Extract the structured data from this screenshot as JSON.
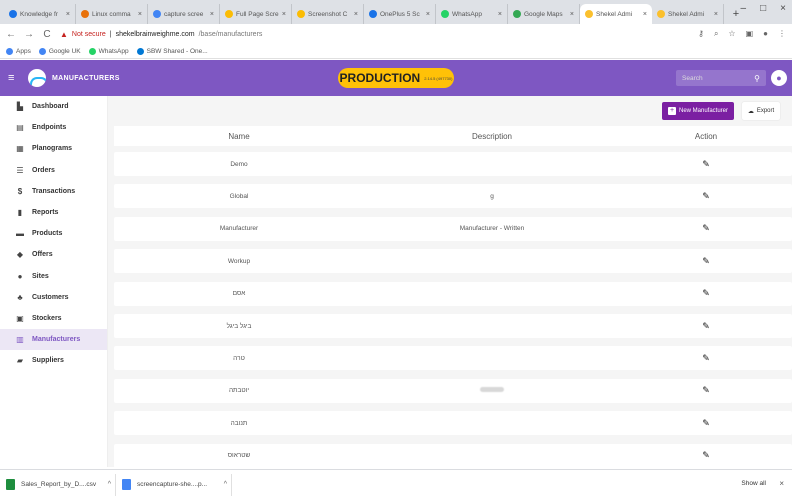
{
  "browser": {
    "tabs": [
      {
        "label": "Knowledge fr",
        "color": "#1a73e8"
      },
      {
        "label": "Linux comma",
        "color": "#e8710a"
      },
      {
        "label": "capture scree",
        "color": "#4285f4"
      },
      {
        "label": "Full Page Scre",
        "color": "#fbbc04"
      },
      {
        "label": "Screenshot C",
        "color": "#fbbc04"
      },
      {
        "label": "OnePlus 5 Sc",
        "color": "#1a73e8"
      },
      {
        "label": "WhatsApp",
        "color": "#25d366"
      },
      {
        "label": "Google Maps",
        "color": "#34a853"
      },
      {
        "label": "Shekel Admi",
        "color": "#fbc02d"
      },
      {
        "label": "Shekel Admi",
        "color": "#fbc02d"
      }
    ],
    "new_tab": "+",
    "window_controls": [
      "–",
      "□",
      "×"
    ],
    "security_label": "Not secure",
    "url_domain": "shekelbrainweighme.com",
    "url_path": "/base/manufacturers",
    "bookmarks": [
      {
        "label": "Apps",
        "color": "#4285f4"
      },
      {
        "label": "Google UK",
        "color": "#4285f4"
      },
      {
        "label": "WhatsApp",
        "color": "#25d366"
      },
      {
        "label": "SBW Shared - One...",
        "color": "#0078d4"
      }
    ]
  },
  "header": {
    "title": "MANUFACTURERS",
    "env_badge": "PRODUCTION",
    "env_badge_small": "2.14.5 (497730)",
    "search_placeholder": "Search",
    "colors": {
      "bar": "#7e57c2",
      "badge": "#ffc107"
    }
  },
  "sidebar": {
    "items": [
      {
        "label": "Dashboard",
        "icon": "▙"
      },
      {
        "label": "Endpoints",
        "icon": "▤"
      },
      {
        "label": "Planograms",
        "icon": "▦"
      },
      {
        "label": "Orders",
        "icon": "☰"
      },
      {
        "label": "Transactions",
        "icon": "$"
      },
      {
        "label": "Reports",
        "icon": "▮"
      },
      {
        "label": "Products",
        "icon": "▬"
      },
      {
        "label": "Offers",
        "icon": "◆"
      },
      {
        "label": "Sites",
        "icon": "●"
      },
      {
        "label": "Customers",
        "icon": "♣"
      },
      {
        "label": "Stockers",
        "icon": "▣"
      },
      {
        "label": "Manufacturers",
        "icon": "▥",
        "active": true
      },
      {
        "label": "Suppliers",
        "icon": "▰"
      }
    ]
  },
  "toolbar": {
    "new_label": "New Manufacturer",
    "export_label": "Export"
  },
  "table": {
    "headers": {
      "name": "Name",
      "description": "Description",
      "action": "Action"
    },
    "rows": [
      {
        "name": "Demo",
        "description": ""
      },
      {
        "name": "Global",
        "description": "g"
      },
      {
        "name": "Manufacturer",
        "description": "Manufacturer - Written"
      },
      {
        "name": "Workup",
        "description": ""
      },
      {
        "name": "אסם",
        "description": ""
      },
      {
        "name": "ביגל ביגל",
        "description": ""
      },
      {
        "name": "טרה",
        "description": ""
      },
      {
        "name": "יוטבתה",
        "description": "[blurred]"
      },
      {
        "name": "תנובה",
        "description": ""
      },
      {
        "name": "שטראוס",
        "description": ""
      }
    ]
  },
  "downloads": {
    "items": [
      {
        "label": "Sales_Report_by_D....csv",
        "color": "#1e8e3e"
      },
      {
        "label": "screencapture-she....p...",
        "color": "#4285f4"
      }
    ],
    "show_all": "Show all",
    "close": "×"
  }
}
